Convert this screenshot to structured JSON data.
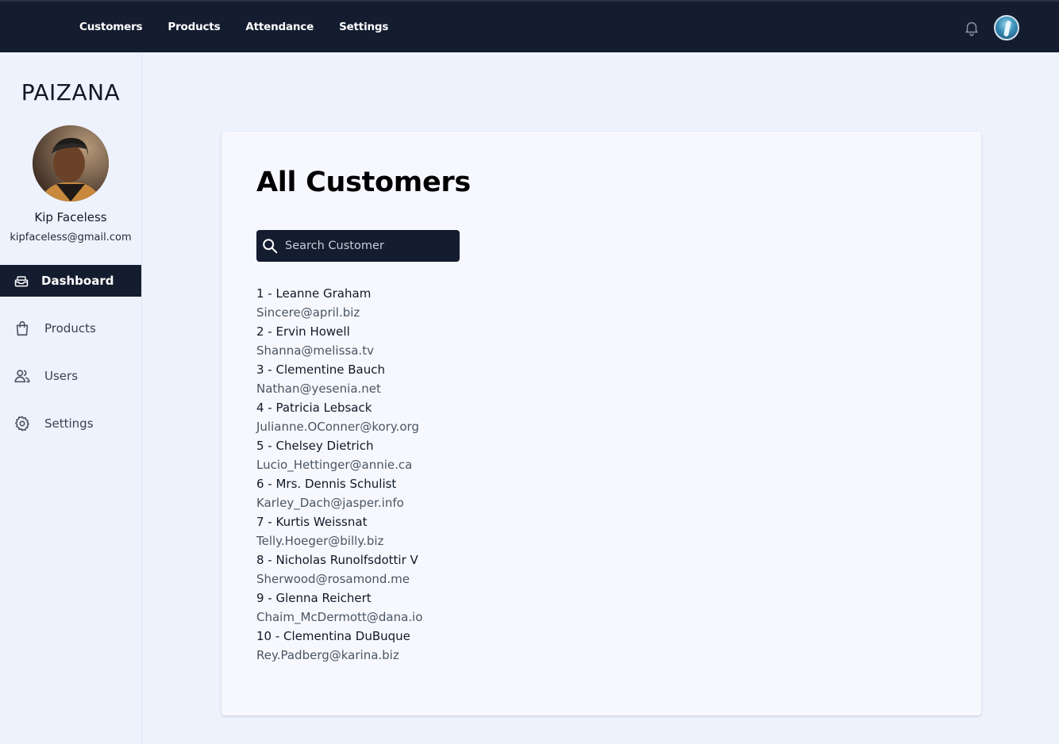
{
  "topbar": {
    "nav": [
      "Customers",
      "Products",
      "Attendance",
      "Settings"
    ],
    "icons": [
      "bell-icon",
      "user-avatar"
    ]
  },
  "sidebar": {
    "brand": "PAIZANA",
    "profile": {
      "name": "Kip Faceless",
      "email": "kipfaceless@gmail.com"
    },
    "items": [
      {
        "label": "Dashboard",
        "icon": "inbox-icon",
        "active": true
      },
      {
        "label": "Products",
        "icon": "shopping-bag-icon",
        "active": false
      },
      {
        "label": "Users",
        "icon": "users-icon",
        "active": false
      },
      {
        "label": "Settings",
        "icon": "gear-icon",
        "active": false
      }
    ]
  },
  "main": {
    "title": "All Customers",
    "search": {
      "placeholder": "Search Customer",
      "value": ""
    },
    "customers": [
      {
        "name": "1 - Leanne Graham",
        "email": "Sincere@april.biz"
      },
      {
        "name": "2 - Ervin Howell",
        "email": "Shanna@melissa.tv"
      },
      {
        "name": "3 - Clementine Bauch",
        "email": "Nathan@yesenia.net"
      },
      {
        "name": "4 - Patricia Lebsack",
        "email": "Julianne.OConner@kory.org"
      },
      {
        "name": "5 - Chelsey Dietrich",
        "email": "Lucio_Hettinger@annie.ca"
      },
      {
        "name": "6 - Mrs. Dennis Schulist",
        "email": "Karley_Dach@jasper.info"
      },
      {
        "name": "7 - Kurtis Weissnat",
        "email": "Telly.Hoeger@billy.biz"
      },
      {
        "name": "8 - Nicholas Runolfsdottir V",
        "email": "Sherwood@rosamond.me"
      },
      {
        "name": "9 - Glenna Reichert",
        "email": "Chaim_McDermott@dana.io"
      },
      {
        "name": "10 - Clementina DuBuque",
        "email": "Rey.Padberg@karina.biz"
      }
    ]
  },
  "colors": {
    "nav_bg": "#141c2f",
    "page_bg": "#eef2fd",
    "card_bg": "#f6f8fe"
  }
}
